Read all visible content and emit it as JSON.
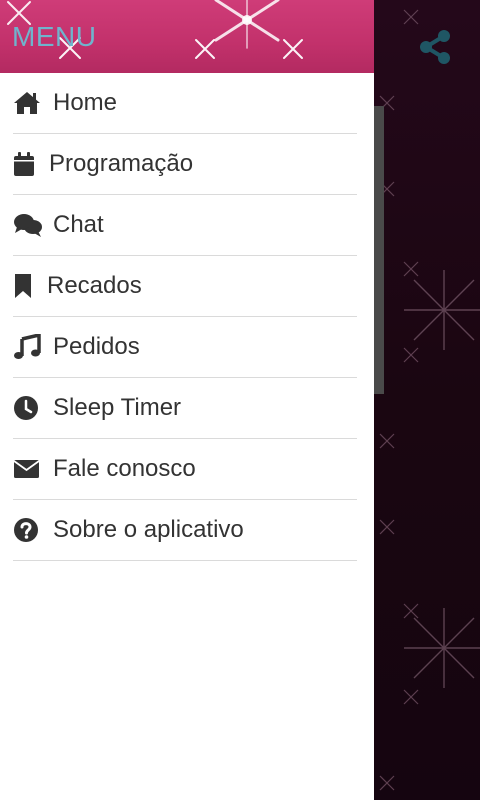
{
  "header": {
    "title": "MENU",
    "title_color": "#6fb4cd",
    "background_color": "#c2316b"
  },
  "toolbar": {
    "share_icon": "share-icon",
    "share_icon_color": "#1f5664"
  },
  "menu": {
    "items": [
      {
        "label": "Home",
        "icon": "home-icon"
      },
      {
        "label": "Programação",
        "icon": "calendar-icon"
      },
      {
        "label": "Chat",
        "icon": "chat-icon"
      },
      {
        "label": "Recados",
        "icon": "bookmark-icon"
      },
      {
        "label": "Pedidos",
        "icon": "music-note-icon"
      },
      {
        "label": "Sleep Timer",
        "icon": "clock-icon"
      },
      {
        "label": "Fale conosco",
        "icon": "envelope-icon"
      },
      {
        "label": "Sobre o aplicativo",
        "icon": "question-circle-icon"
      }
    ]
  },
  "colors": {
    "drawer_background": "#ffffff",
    "text": "#333333",
    "divider": "#dadada",
    "page_background": "#1a0710"
  }
}
